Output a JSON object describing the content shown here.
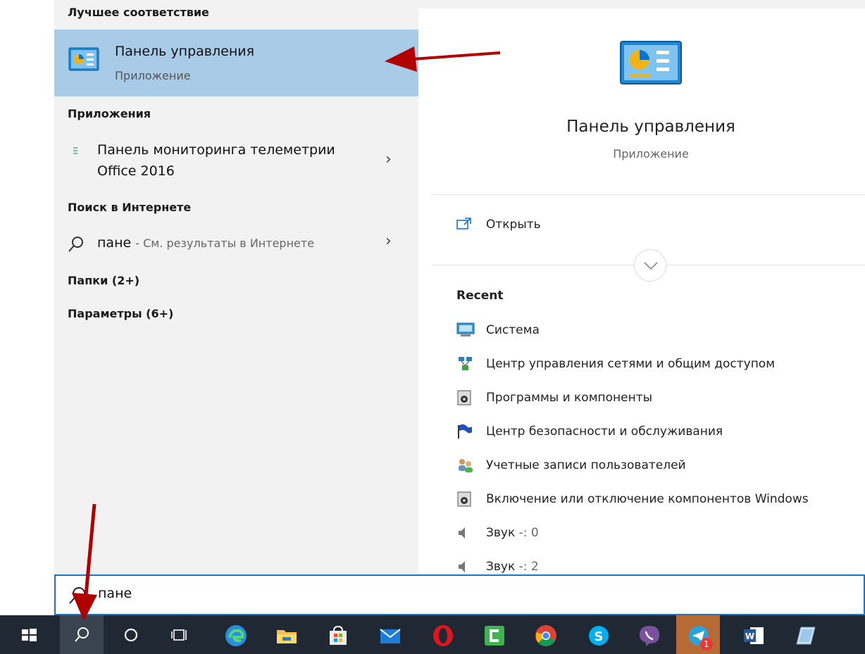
{
  "left": {
    "best_match_header": "Лучшее соответствие",
    "best_match": {
      "title": "Панель управления",
      "subtitle": "Приложение"
    },
    "apps_header": "Приложения",
    "app_item": {
      "line1": "Панель мониторинга телеметрии",
      "line2": "Office 2016"
    },
    "web_header": "Поиск в Интернете",
    "web_item": {
      "query": "пане",
      "suffix": "- См. результаты в Интернете"
    },
    "folders": "Папки (2+)",
    "settings": "Параметры (6+)"
  },
  "preview": {
    "title": "Панель управления",
    "subtitle": "Приложение",
    "open_label": "Открыть",
    "recent_header": "Recent",
    "recent": [
      {
        "label": "Система",
        "suffix": ""
      },
      {
        "label": "Центр управления сетями и общим доступом",
        "suffix": ""
      },
      {
        "label": "Программы и компоненты",
        "suffix": ""
      },
      {
        "label": "Центр безопасности и обслуживания",
        "suffix": ""
      },
      {
        "label": "Учетные записи пользователей",
        "suffix": ""
      },
      {
        "label": "Включение или отключение компонентов Windows",
        "suffix": ""
      },
      {
        "label": "Звук",
        "suffix": "-: 0"
      },
      {
        "label": "Звук",
        "suffix": "-: 2"
      }
    ]
  },
  "search": {
    "value": "пане"
  },
  "taskbar": {
    "badge": "1",
    "icons": [
      "windows-start-icon",
      "search-icon",
      "cortana-icon",
      "task-view-icon",
      "edge-icon",
      "file-explorer-icon",
      "store-icon",
      "mail-icon",
      "opera-icon",
      "camtasia-icon",
      "chrome-icon",
      "skype-icon",
      "viber-icon",
      "telegram-icon",
      "word-icon",
      "notes-icon"
    ]
  },
  "colors": {
    "highlight": "#a8cce8",
    "accent": "#1976c7",
    "taskbar": "#1f2833",
    "arrow": "#b00000"
  }
}
